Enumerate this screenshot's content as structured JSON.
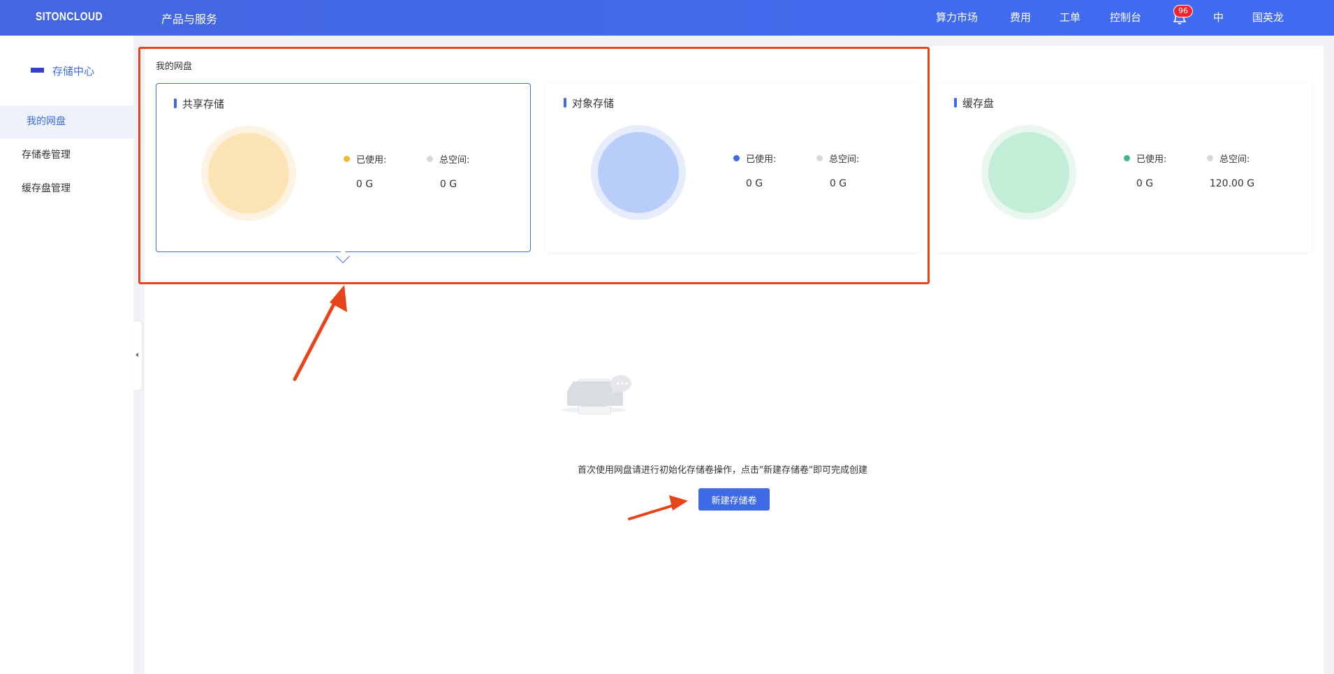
{
  "topbar": {
    "logo": "SITONCLOUD",
    "products": "产品与服务",
    "links": [
      "算力市场",
      "费用",
      "工单",
      "控制台"
    ],
    "notify_count": "96",
    "lang": "中",
    "user": "国英龙"
  },
  "sidebar": {
    "title": "存储中心",
    "items": [
      {
        "label": "我的网盘"
      },
      {
        "label": "存储卷管理"
      },
      {
        "label": "缓存盘管理"
      }
    ]
  },
  "main": {
    "title": "我的网盘",
    "cards": [
      {
        "title": "共享存储",
        "used_label": "已使用:",
        "total_label": "总空间:",
        "used": "0 G",
        "total": "0 G",
        "color": "#fde4b6",
        "ring": "#fdf3e2",
        "dot": "#f7b731"
      },
      {
        "title": "对象存储",
        "used_label": "已使用:",
        "total_label": "总空间:",
        "used": "0 G",
        "total": "0 G",
        "color": "#b9cdfa",
        "ring": "#e6ecfc",
        "dot": "#3e6ae5"
      },
      {
        "title": "缓存盘",
        "used_label": "已使用:",
        "total_label": "总空间:",
        "used": "0 G",
        "total": "120.00 G",
        "color": "#c2eed7",
        "ring": "#e9f7ef",
        "dot": "#3fba7a"
      }
    ],
    "empty_text": "首次使用网盘请进行初始化存储卷操作，点击\"新建存储卷\"即可完成创建",
    "new_button": "新建存储卷"
  },
  "colors": {
    "accent": "#3e6ae5",
    "annotation": "#e8441c"
  }
}
